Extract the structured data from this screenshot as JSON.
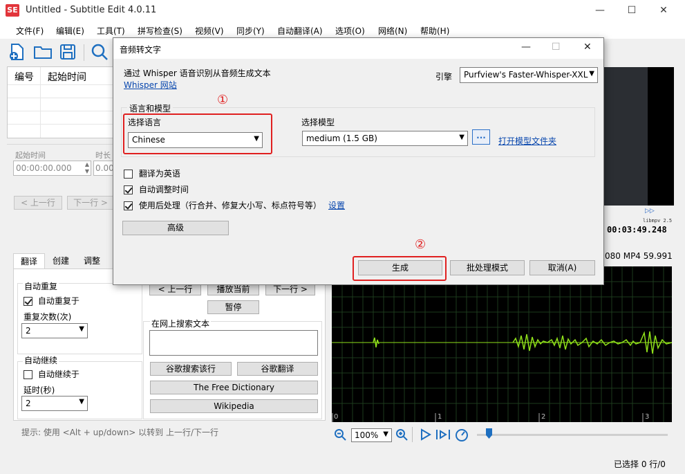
{
  "window": {
    "title": "Untitled - Subtitle Edit 4.0.11",
    "icon_text": "SE",
    "minimize": "—",
    "maximize": "☐",
    "close": "✕"
  },
  "menu": [
    "文件(F)",
    "编辑(E)",
    "工具(T)",
    "拼写检查(S)",
    "视频(V)",
    "同步(Y)",
    "自动翻译(A)",
    "选项(O)",
    "网络(N)",
    "帮助(H)"
  ],
  "toolbar": {
    "icons": [
      "new-file-icon",
      "open-folder-icon",
      "save-icon",
      "search-icon"
    ]
  },
  "grid": {
    "col_number": "编号",
    "col_start": "起始时间"
  },
  "edit": {
    "start_label": "起始时间",
    "duration_label": "时长",
    "start_value": "00:00:00.000",
    "duration_value": "0.00",
    "prev_line": "< 上一行",
    "next_line": "下一行 >"
  },
  "tabs": [
    "翻译",
    "创建",
    "调整"
  ],
  "translate_panel": {
    "auto_repeat_title": "自动重复",
    "auto_repeat_on": "自动重复于",
    "repeat_count_label": "重复次数(次)",
    "repeat_count_value": "2",
    "auto_continue_title": "自动继续",
    "auto_continue_on": "自动继续于",
    "delay_label": "延时(秒)",
    "delay_value": "2",
    "prev_btn": "< 上一行",
    "play_current_btn": "播放当前",
    "next_btn": "下一行 >",
    "pause_btn": "暂停",
    "search_online_label": "在网上搜索文本",
    "google_search_btn": "谷歌搜索该行",
    "google_translate_btn": "谷歌翻译",
    "free_dict_btn": "The Free Dictionary",
    "wikipedia_btn": "Wikipedia",
    "hint": "提示: 使用 <Alt + up/down> 以转到 上一行/下一行"
  },
  "video": {
    "player_label": "libmpv 2.5",
    "timecode": "00:03:49.248",
    "info": "080 MP4 59.991"
  },
  "waveform": {
    "ticks": [
      "0",
      "1",
      "2",
      "3"
    ],
    "zoom_value": "100%"
  },
  "status": {
    "selection": "已选择 0 行/0"
  },
  "dialog": {
    "title": "音频转文字",
    "description": "通过 Whisper 语音识别从音频生成文本",
    "site_link": "Whisper 网站",
    "engine_label": "引擎",
    "engine_value": "Purfview's Faster-Whisper-XXL",
    "group_title": "语言和模型",
    "language_label": "选择语言",
    "language_value": "Chinese",
    "model_label": "选择模型",
    "model_value": "medium (1.5 GB)",
    "browse_button": "...",
    "open_model_folder": "打开模型文件夹",
    "translate_english": "翻译为英语",
    "auto_adjust": "自动调整时间",
    "post_process": "使用后处理（行合并、修复大小写、标点符号等）",
    "settings_link": "设置",
    "advanced_button": "高级",
    "generate_button": "生成",
    "batch_button": "批处理模式",
    "cancel_button": "取消(A)",
    "marker1": "①",
    "marker2": "②"
  },
  "colors": {
    "accent_red": "#e02020",
    "wave_green": "#8fe01a",
    "link_blue": "#0645ad"
  }
}
